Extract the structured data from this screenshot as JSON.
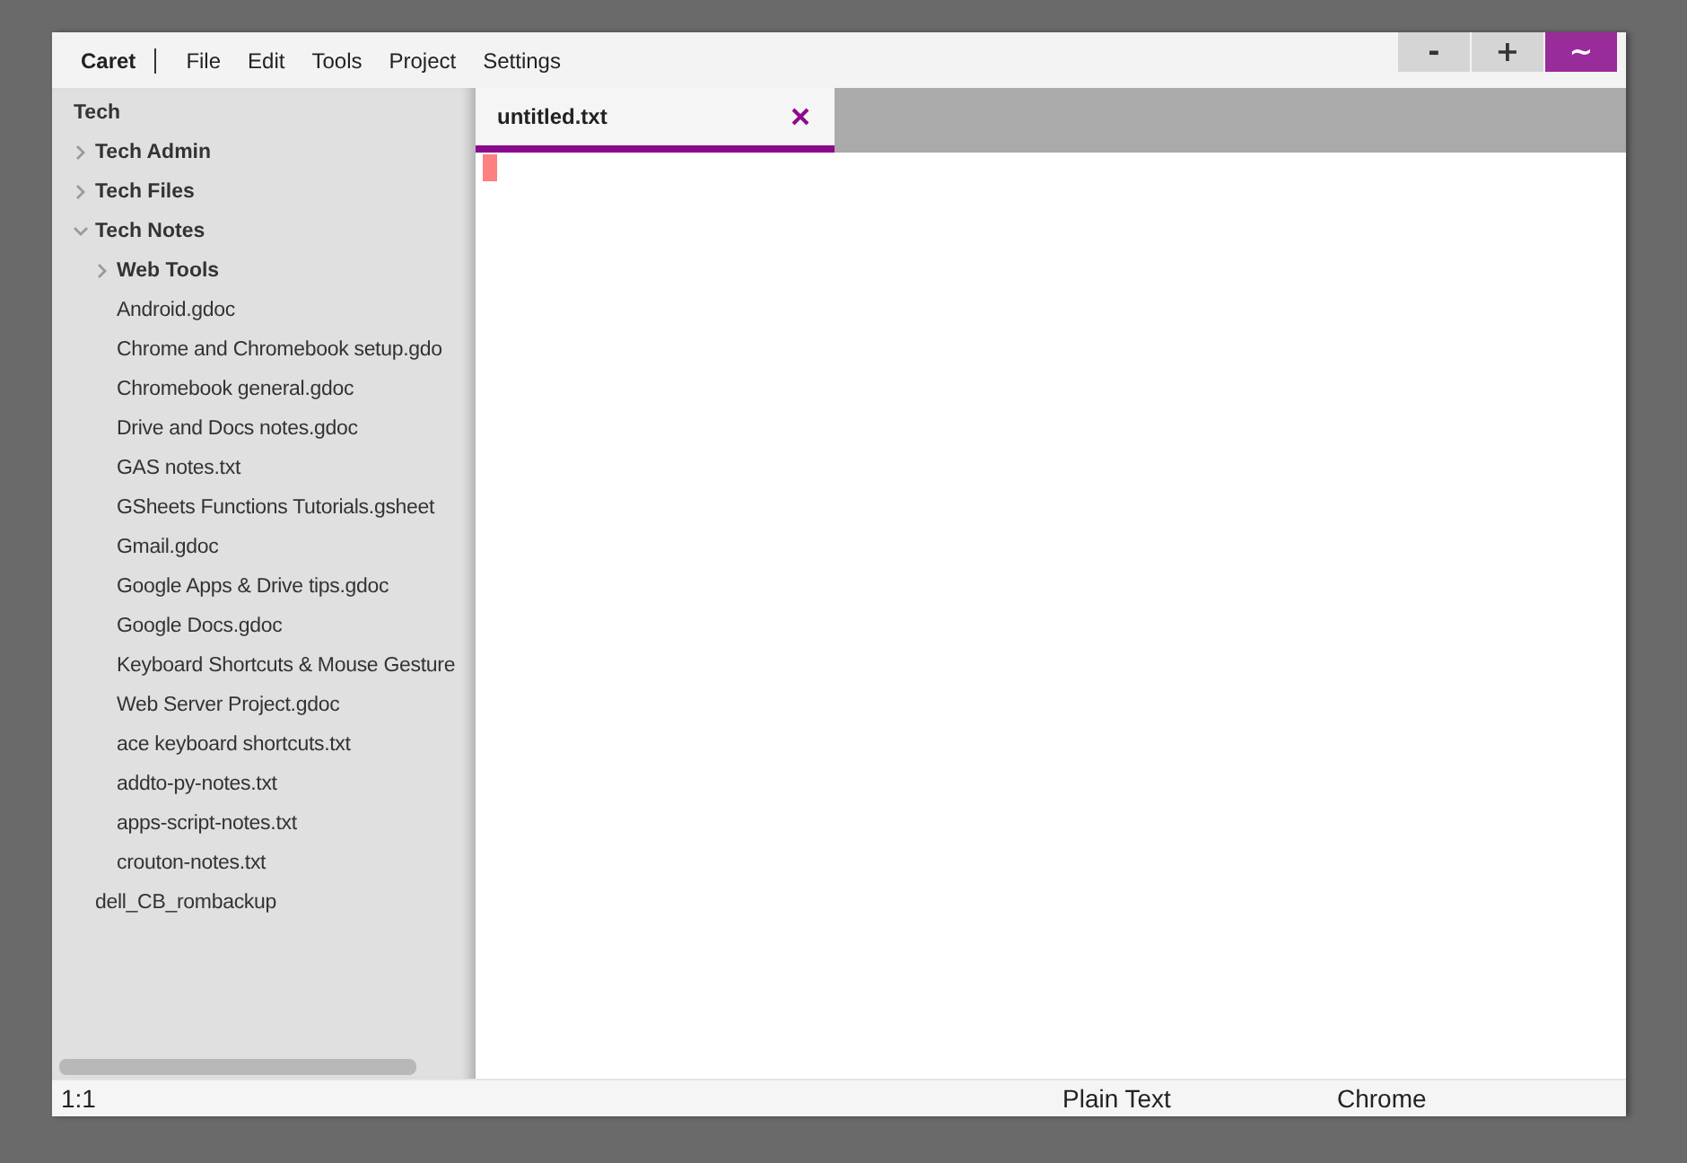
{
  "app": {
    "title": "Caret"
  },
  "menu": [
    "File",
    "Edit",
    "Tools",
    "Project",
    "Settings"
  ],
  "window_controls": [
    {
      "label": "-",
      "active": false
    },
    {
      "label": "+",
      "active": false
    },
    {
      "label": "~",
      "active": true
    }
  ],
  "sidebar": {
    "tree": {
      "label": "Tech",
      "kind": "project",
      "children": [
        {
          "label": "Tech Admin",
          "kind": "folder",
          "expanded": false
        },
        {
          "label": "Tech Files",
          "kind": "folder",
          "expanded": false
        },
        {
          "label": "Tech Notes",
          "kind": "folder",
          "expanded": true,
          "children": [
            {
              "label": "Web Tools",
              "kind": "folder",
              "expanded": false
            },
            {
              "label": "Android.gdoc",
              "kind": "file"
            },
            {
              "label": "Chrome and Chromebook setup.gdo",
              "kind": "file"
            },
            {
              "label": "Chromebook general.gdoc",
              "kind": "file"
            },
            {
              "label": "Drive and Docs notes.gdoc",
              "kind": "file"
            },
            {
              "label": "GAS notes.txt",
              "kind": "file"
            },
            {
              "label": "GSheets Functions Tutorials.gsheet",
              "kind": "file"
            },
            {
              "label": "Gmail.gdoc",
              "kind": "file"
            },
            {
              "label": "Google Apps & Drive tips.gdoc",
              "kind": "file"
            },
            {
              "label": "Google Docs.gdoc",
              "kind": "file"
            },
            {
              "label": "Keyboard Shortcuts & Mouse Gesture",
              "kind": "file"
            },
            {
              "label": "Web Server Project.gdoc",
              "kind": "file"
            },
            {
              "label": "ace keyboard shortcuts.txt",
              "kind": "file"
            },
            {
              "label": "addto-py-notes.txt",
              "kind": "file"
            },
            {
              "label": "apps-script-notes.txt",
              "kind": "file"
            },
            {
              "label": "crouton-notes.txt",
              "kind": "file"
            }
          ]
        },
        {
          "label": "dell_CB_rombackup",
          "kind": "file"
        }
      ]
    }
  },
  "tabs": [
    {
      "label": "untitled.txt",
      "selected": true
    }
  ],
  "status_bar": {
    "position": "1:1",
    "mode": "Plain Text",
    "theme": "Chrome"
  }
}
